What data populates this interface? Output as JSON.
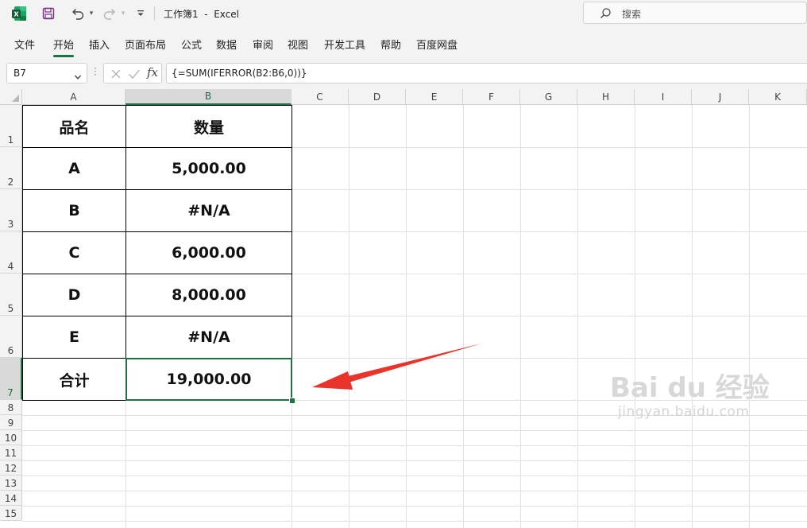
{
  "window": {
    "app_title": "工作簿1  -  Excel",
    "search_placeholder": "搜索"
  },
  "icons": {
    "app": "excel-logo-icon",
    "save": "save-icon",
    "undo": "undo-icon",
    "redo": "redo-icon",
    "qat": "customize-quick-access-icon",
    "search": "search-icon"
  },
  "ribbon": {
    "tabs": [
      "文件",
      "开始",
      "插入",
      "页面布局",
      "公式",
      "数据",
      "审阅",
      "视图",
      "开发工具",
      "帮助",
      "百度网盘"
    ],
    "active_tab": "开始"
  },
  "formula_bar": {
    "name_box": "B7",
    "fx_label": "fx",
    "formula": "{=SUM(IFERROR(B2:B6,0))}"
  },
  "sheet": {
    "columns": [
      "A",
      "B",
      "C",
      "D",
      "E",
      "F",
      "G",
      "H",
      "I",
      "J",
      "K"
    ],
    "rows": [
      "1",
      "2",
      "3",
      "4",
      "5",
      "6",
      "7",
      "8",
      "9",
      "10",
      "11",
      "12",
      "13",
      "14",
      "15"
    ],
    "selected_cell": "B7",
    "table": {
      "header": [
        "品名",
        "数量"
      ],
      "rows": [
        [
          "A",
          "5,000.00"
        ],
        [
          "B",
          "#N/A"
        ],
        [
          "C",
          "6,000.00"
        ],
        [
          "D",
          "8,000.00"
        ],
        [
          "E",
          "#N/A"
        ],
        [
          "合计",
          "19,000.00"
        ]
      ]
    }
  },
  "annotation": {
    "arrow_color": "#e8342a"
  },
  "watermark": {
    "brand": "Bai du 经验",
    "url": "jingyan.baidu.com"
  },
  "colors": {
    "accent": "#1e7145",
    "chrome": "#f3f3f3"
  }
}
